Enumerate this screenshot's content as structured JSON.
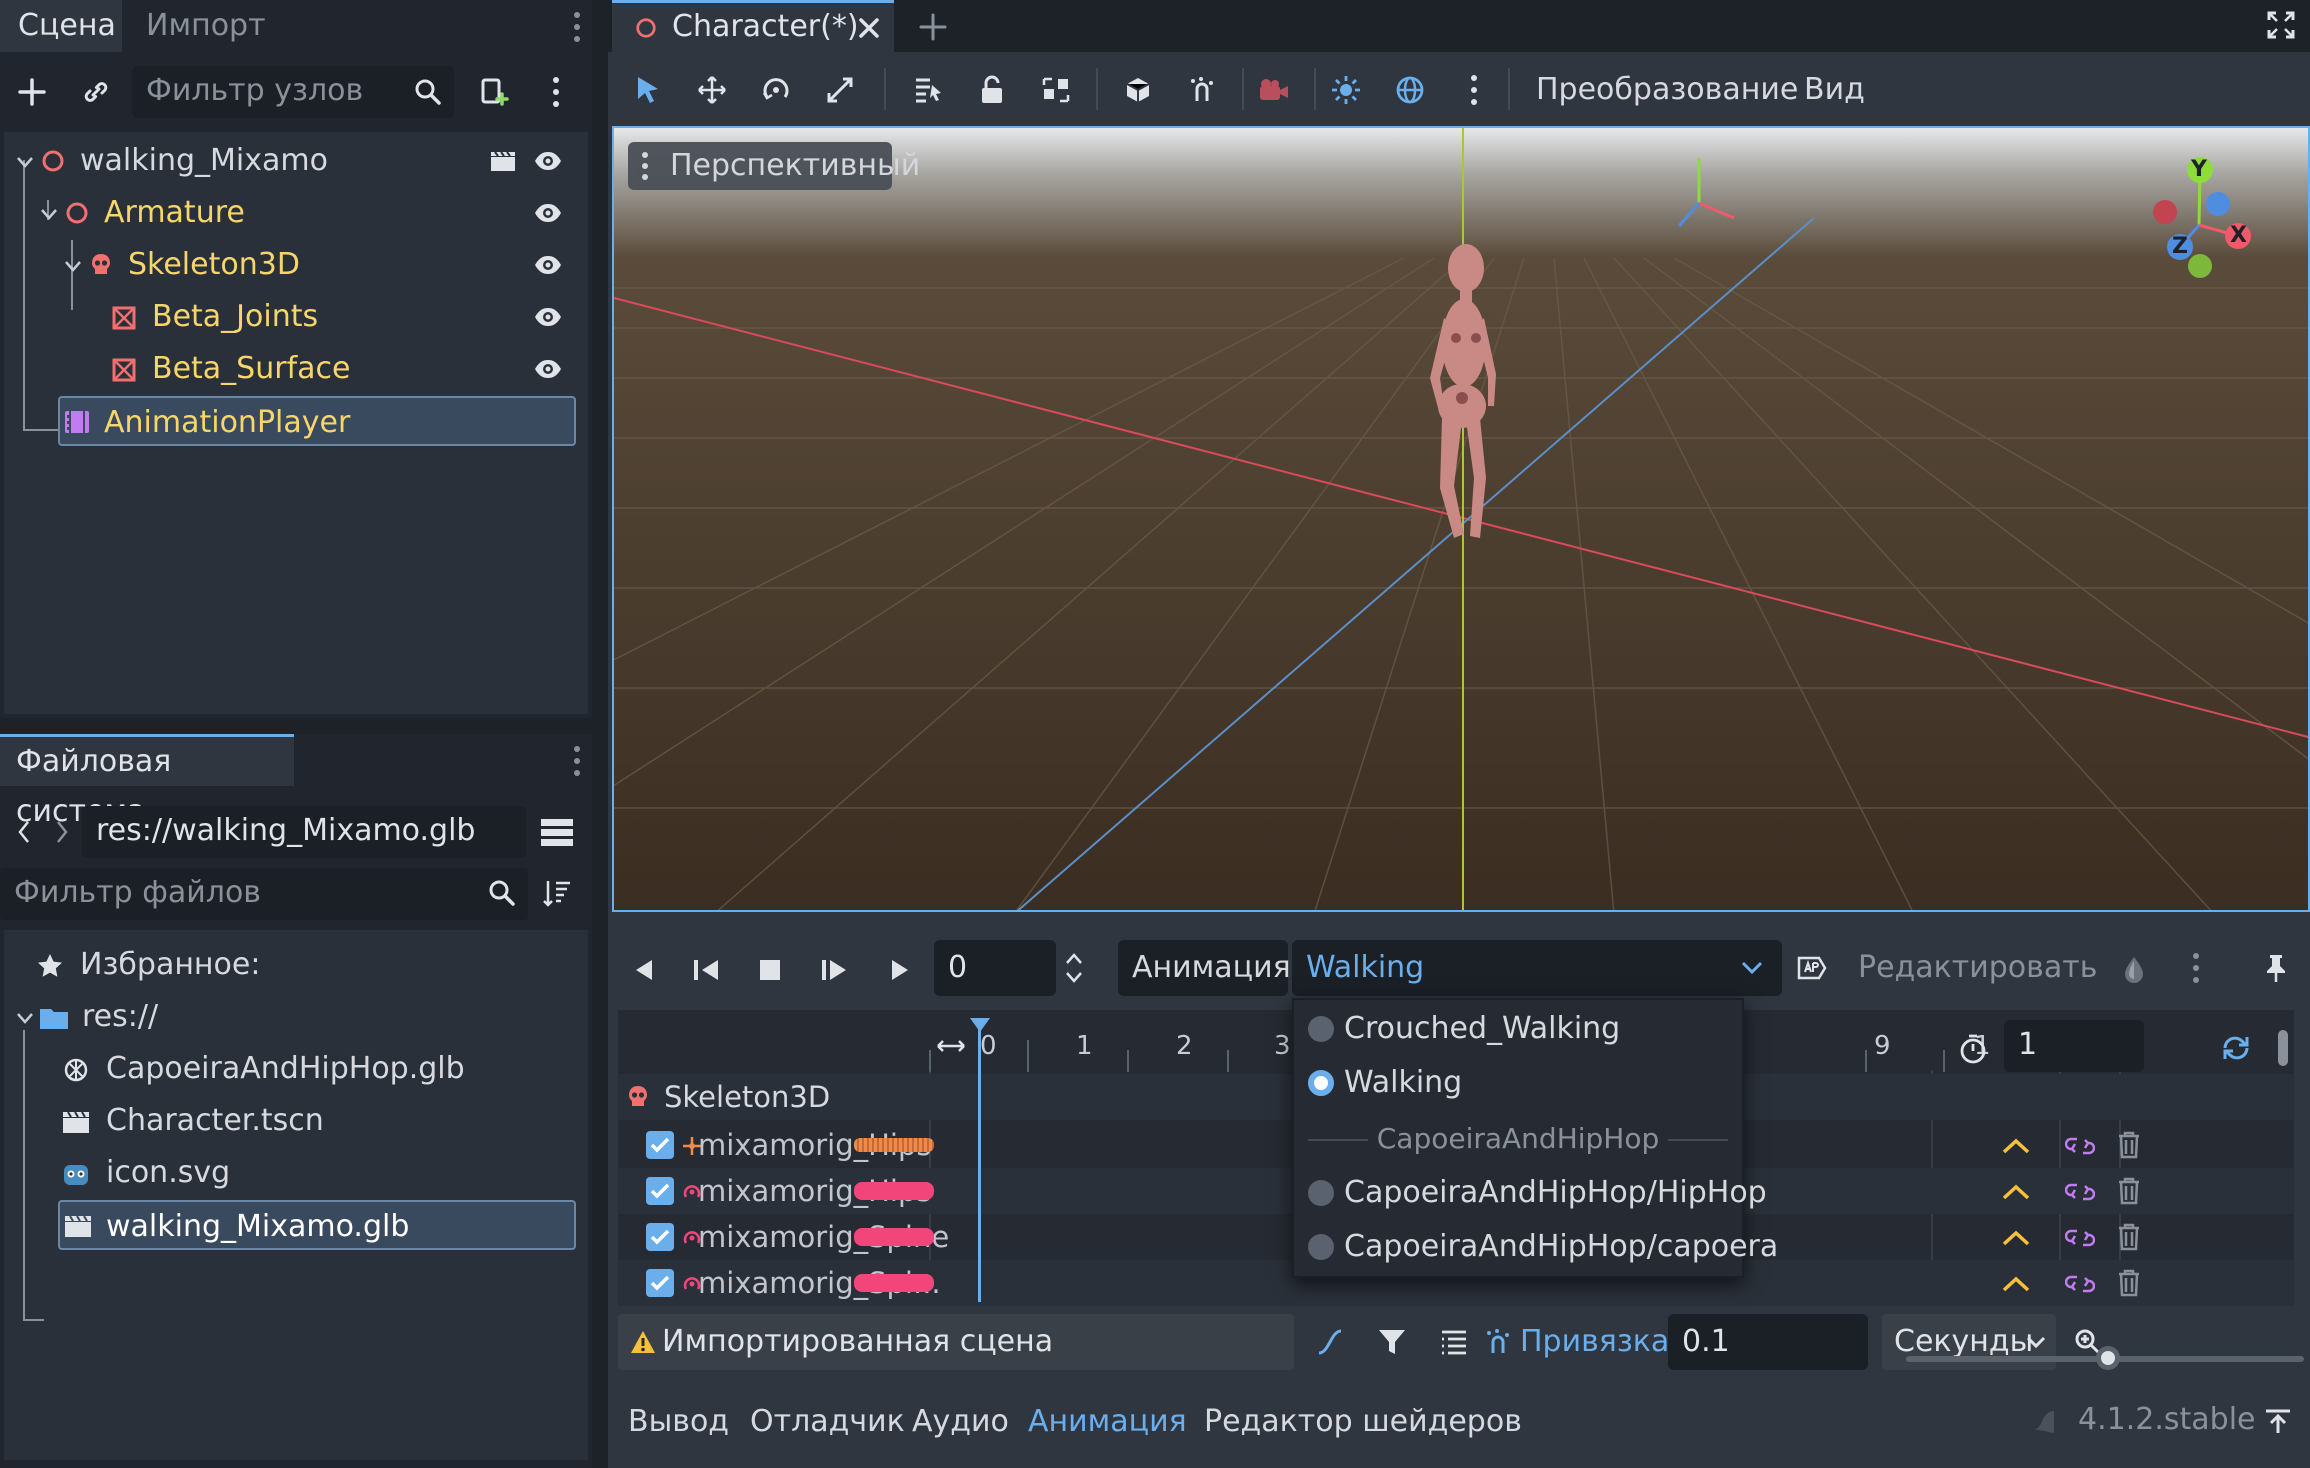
{
  "scene_dock": {
    "tabs": [
      "Сцена",
      "Импорт"
    ],
    "filter_placeholder": "Фильтр узлов",
    "nodes": [
      {
        "label": "walking_Mixamo",
        "icon": "node3d-icon",
        "depth": 0
      },
      {
        "label": "Armature",
        "icon": "node3d-icon",
        "depth": 1
      },
      {
        "label": "Skeleton3D",
        "icon": "skeleton-icon",
        "depth": 2
      },
      {
        "label": "Beta_Joints",
        "icon": "mesh-icon",
        "depth": 3
      },
      {
        "label": "Beta_Surface",
        "icon": "mesh-icon",
        "depth": 3
      },
      {
        "label": "AnimationPlayer",
        "icon": "animation-player-icon",
        "depth": 1
      }
    ]
  },
  "filesystem": {
    "tab": "Файловая система",
    "path": "res://walking_Mixamo.glb",
    "filter_placeholder": "Фильтр файлов",
    "favorites": "Избранное:",
    "root": "res://",
    "files": [
      "CapoeiraAndHipHop.glb",
      "Character.tscn",
      "icon.svg",
      "walking_Mixamo.glb"
    ]
  },
  "editor_tab": {
    "label": "Character(*)"
  },
  "toolbar": {
    "transform_menu": "Преобразование",
    "view_menu": "Вид"
  },
  "viewport": {
    "perspective_label": "Перспективный",
    "gizmo": {
      "x": "X",
      "y": "Y",
      "z": "Z"
    }
  },
  "animation_panel": {
    "time_value": "0",
    "animation_label": "Анимация",
    "current_animation": "Walking",
    "edit_label": "Редактировать",
    "length_value": "1",
    "ruler": [
      "0",
      "1",
      "2",
      "3",
      "9",
      "1"
    ],
    "group": "Skeleton3D",
    "tracks": [
      "mixamorig_Hips",
      "mixamorig_Hips",
      "mixamorig_Spine",
      "mixamorig_Spi..."
    ],
    "dropdown": {
      "items": [
        "Crouched_Walking",
        "Walking"
      ],
      "separator": "CapoeiraAndHipHop",
      "group_items": [
        "CapoeiraAndHipHop/HipHop",
        "CapoeiraAndHipHop/capoera"
      ]
    },
    "imported_warning": "Импортированная сцена",
    "snap_label": "Привязка:",
    "snap_value": "0.1",
    "snap_unit": "Секунды"
  },
  "bottom_tabs": [
    "Вывод",
    "Отладчик",
    "Аудио",
    "Анимация",
    "Редактор шейдеров"
  ],
  "version": "4.1.2.stable",
  "colors": {
    "accent": "#6aaeec",
    "node_yellow": "#f6d66b",
    "track_pink": "#f2467a",
    "track_orange": "#f08a4b"
  }
}
